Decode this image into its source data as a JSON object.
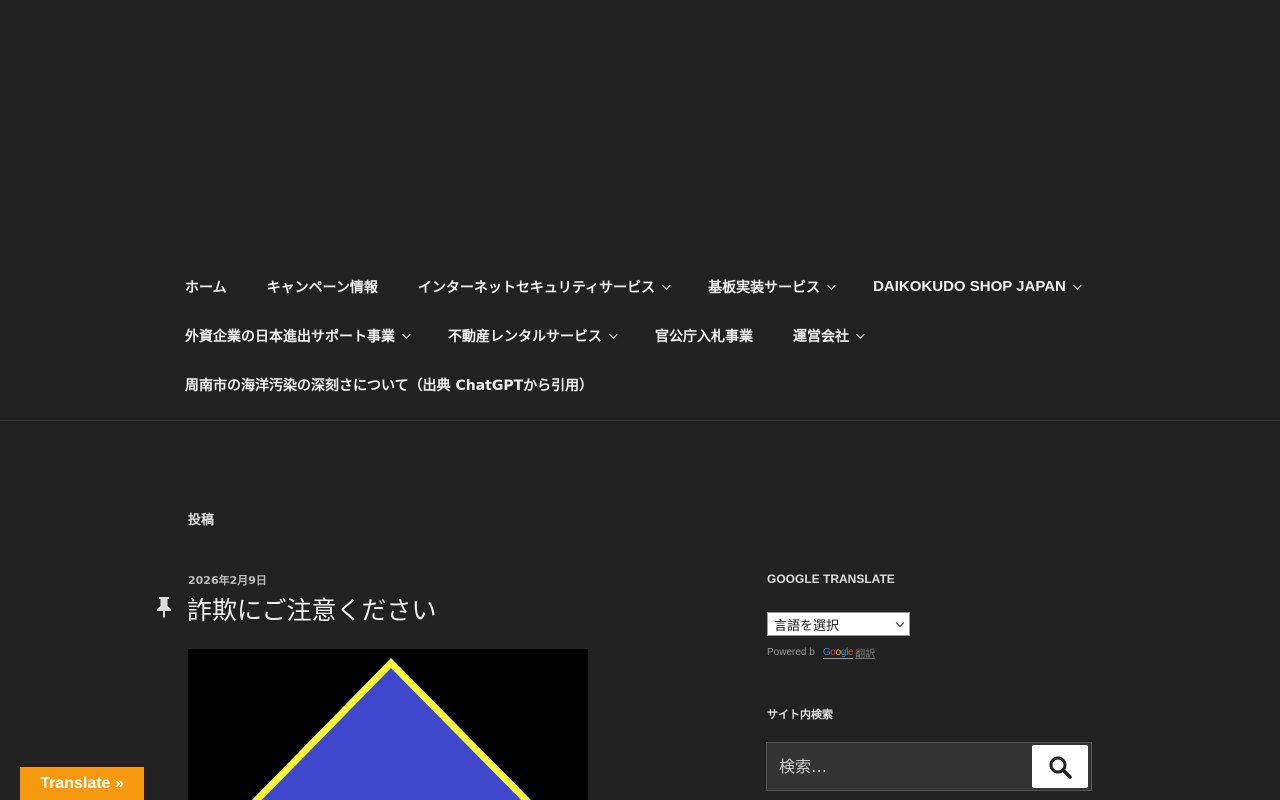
{
  "nav": {
    "rows": [
      [
        {
          "label": "ホーム",
          "dropdown": false
        },
        {
          "label": "キャンペーン情報",
          "dropdown": false
        },
        {
          "label": "インターネットセキュリティサービス",
          "dropdown": true
        },
        {
          "label": "基板実装サービス",
          "dropdown": true
        },
        {
          "label": "DAIKOKUDO SHOP JAPAN",
          "dropdown": true
        }
      ],
      [
        {
          "label": "外資企業の日本進出サポート事業",
          "dropdown": true
        },
        {
          "label": "不動産レンタルサービス",
          "dropdown": true
        },
        {
          "label": "官公庁入札事業",
          "dropdown": false
        },
        {
          "label": "運営会社",
          "dropdown": true
        }
      ],
      [
        {
          "label": "周南市の海洋汚染の深刻さについて（出典 ChatGPTから引用）",
          "dropdown": false
        }
      ]
    ]
  },
  "content": {
    "section_label": "投稿",
    "post": {
      "date": "2026年2月9日",
      "title": "詐欺にご注意ください",
      "sticky_icon": "pin-icon",
      "image_colors": {
        "background": "#000000",
        "fill": "#3f47cc",
        "outline": "#f5f53c"
      }
    }
  },
  "sidebar": {
    "translate_widget": {
      "title": "GOOGLE TRANSLATE",
      "select_value": "言語を選択",
      "powered_by": "Powered b",
      "google": "Google",
      "translate_link": "翻訳"
    },
    "search_widget": {
      "title": "サイト内検索",
      "placeholder": "検索…",
      "button_icon": "search-icon"
    }
  },
  "translate_float": {
    "label": "Translate »",
    "color": "#f6990f"
  }
}
